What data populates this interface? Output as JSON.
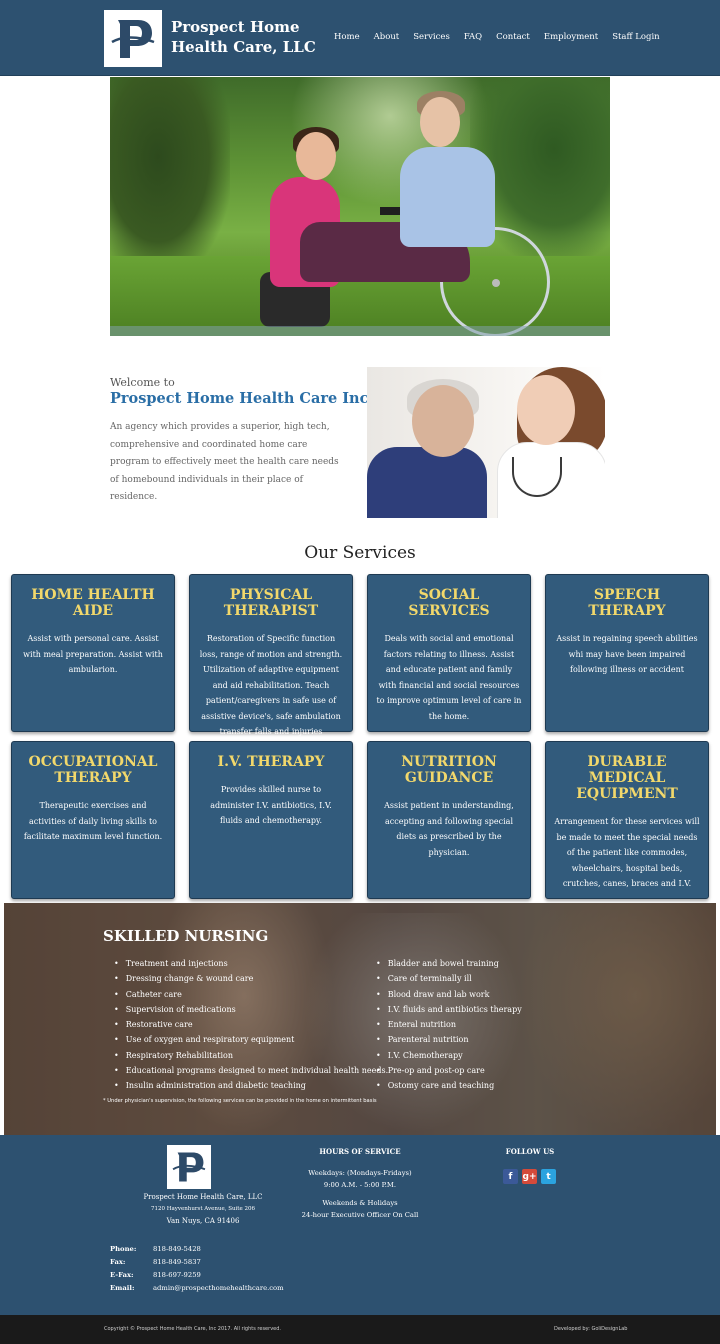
{
  "header": {
    "brand_line1": "Prospect Home",
    "brand_line2": "Health Care, LLC",
    "nav": [
      "Home",
      "About",
      "Services",
      "FAQ",
      "Contact",
      "Employment",
      "Staff Login"
    ]
  },
  "welcome": {
    "small": "Welcome to",
    "title": "Prospect Home Health Care Inc.",
    "text": "An agency which provides a superior, high tech, comprehensive and coordinated home care program to effectively meet the health care needs of homebound individuals in their place of residence."
  },
  "services": {
    "title": "Our Services",
    "cards": [
      {
        "title": "HOME HEALTH AIDE",
        "text": "Assist with personal care. Assist with meal preparation. Assist with ambularion."
      },
      {
        "title": "PHYSICAL THERAPIST",
        "text": "Restoration of Specific function loss, range of motion and strength. Utilization of adaptive equipment and aid rehabilitation. Teach patient/caregivers in safe use of assistive device's, safe ambulation transfer falls and injuries"
      },
      {
        "title": "SOCIAL SERVICES",
        "text": "Deals with social and emotional factors relating to illness. Assist and educate patient and family with financial and social resources to improve optimum level of care in the home."
      },
      {
        "title": "SPEECH THERAPY",
        "text": "Assist in regaining speech abilities whi may have been impaired following illness or accident"
      },
      {
        "title": "OCCUPATIONAL THERAPY",
        "text": "Therapeutic exercises and activities of daily living skills to facilitate maximum level function."
      },
      {
        "title": "I.V. THERAPY",
        "text": "Provides skilled nurse to administer I.V. antibiotics, I.V. fluids and chemotherapy."
      },
      {
        "title": "NUTRITION GUIDANCE",
        "text": "Assist patient in understanding, accepting and following special diets as prescribed by the physician."
      },
      {
        "title": "DURABLE MEDICAL EQUIPMENT",
        "text": "Arrangement for these services will be made to meet the special needs of the patient like commodes, wheelchairs, hospital beds, crutches, canes, braces and I.V."
      }
    ]
  },
  "skilled": {
    "title": "SKILLED NURSING",
    "left": [
      "Treatment and injections",
      "Dressing change & wound care",
      "Catheter care",
      "Supervision of medications",
      "Restorative care",
      "Use of oxygen and respiratory equipment",
      "Respiratory Rehabilitation",
      "Educational programs designed to meet individual health needs.",
      "Insulin administration and diabetic teaching"
    ],
    "right": [
      "Bladder and bowel training",
      "Care of terminally ill",
      "Blood draw and lab work",
      "I.V. fluids and antibiotics therapy",
      "Enteral nutrition",
      "Parenteral nutrition",
      "I.V. Chemotherapy",
      "Pre-op and post-op care",
      "Ostomy care and teaching"
    ],
    "note": "* Under physician's supervision, the following services can be provided in the home on intermittent basis"
  },
  "footer": {
    "company": "Prospect Home Health Care, LLC",
    "address1": "7120 Hayvenhurst Avenue, Suite 206",
    "address2": "Van Nuys, CA 91406",
    "contacts": [
      {
        "label": "Phone:",
        "value": "818-849-5428"
      },
      {
        "label": "Fax:",
        "value": "818-849-5837"
      },
      {
        "label": "E-Fax:",
        "value": "818-697-9259"
      },
      {
        "label": "Email:",
        "value": "admin@prospecthomehealthcare.com"
      }
    ],
    "hours_heading": "HOURS OF SERVICE",
    "hours_weekdays": "Weekdays: (Mondays-Fridays)",
    "hours_time": "9:00 A.M. - 5:00 P.M.",
    "hours_weekends": "Weekends & Holidays",
    "hours_oncall": "24-hour Executive Officer On Call",
    "follow_heading": "FOLLOW US",
    "social": [
      "facebook-icon",
      "google-plus-icon",
      "twitter-icon"
    ]
  },
  "bottom": {
    "copyright": "Copyright © Prospect Home Health Care, Inc 2017. All rights reserved.",
    "developer": "Developed by: GoliDesignLab"
  },
  "colors": {
    "header_bg": "#2d5170",
    "card_bg": "#325b7c",
    "card_title": "#f2d86b",
    "welcome_title": "#2a6ea6",
    "bottom_bar": "#1a1a1a"
  }
}
